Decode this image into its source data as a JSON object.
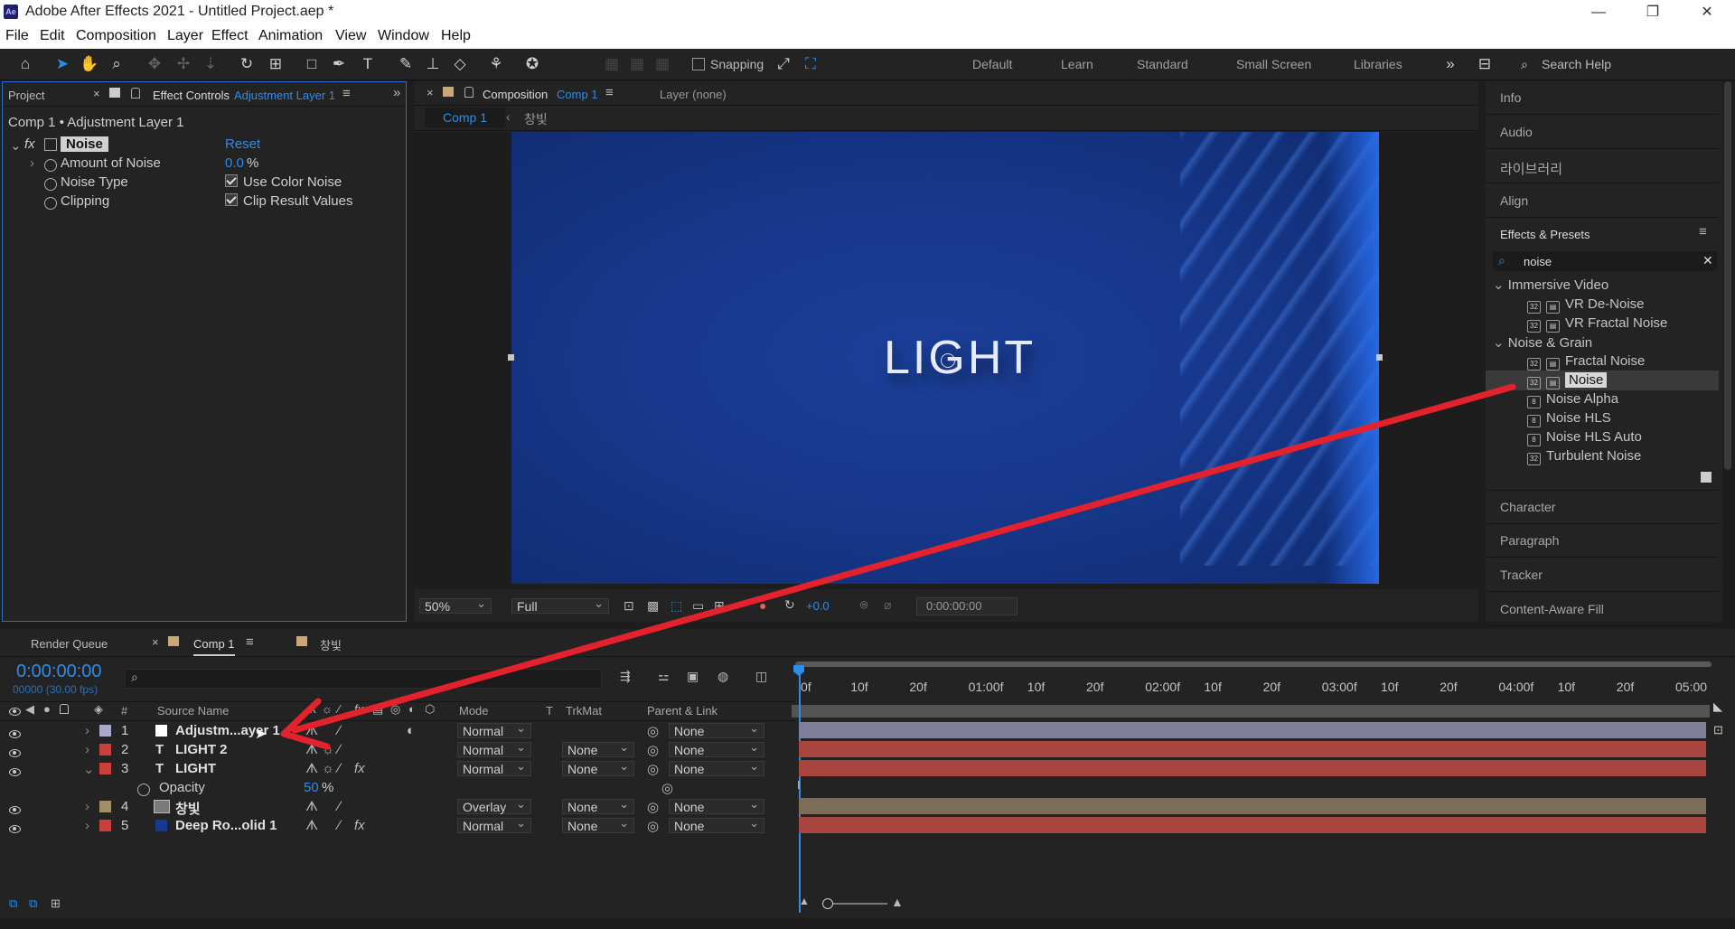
{
  "app": {
    "title": "Adobe After Effects 2021 - Untitled Project.aep *",
    "icon_text": "Ae"
  },
  "menu": [
    "File",
    "Edit",
    "Composition",
    "Layer",
    "Effect",
    "Animation",
    "View",
    "Window",
    "Help"
  ],
  "toolbar": {
    "snapping_label": "Snapping",
    "workspaces": [
      "Default",
      "Learn",
      "Standard",
      "Small Screen",
      "Libraries"
    ],
    "search_placeholder": "Search Help"
  },
  "project_panel": {
    "tab_project": "Project",
    "tab_effect_controls": "Effect Controls",
    "effect_controls_target": "Adjustment Layer 1"
  },
  "effect_controls": {
    "breadcrumb": "Comp 1 • Adjustment Layer 1",
    "effect_name": "Noise",
    "reset_label": "Reset",
    "fx_label": "fx",
    "props": [
      {
        "name": "Amount of Noise",
        "value": "0.0",
        "unit": "%"
      },
      {
        "name": "Noise Type",
        "checkbox_label": "Use Color Noise"
      },
      {
        "name": "Clipping",
        "checkbox_label": "Clip Result Values"
      }
    ]
  },
  "composition_panel": {
    "tab_label": "Composition",
    "tab_comp": "Comp 1",
    "layer_tab": "Layer (none)",
    "sub_tabs": [
      "Comp 1",
      "창빛"
    ],
    "viewer_text": "LIGHT",
    "zoom": "50%",
    "resolution": "Full",
    "exposure": "+0.0",
    "timecode": "0:00:00:00"
  },
  "right_panel": {
    "items_top": [
      "Info",
      "Audio",
      "라이브러리",
      "Align"
    ],
    "effects_presets": {
      "title": "Effects & Presets",
      "search_value": "noise",
      "groups": [
        {
          "name": "Immersive Video",
          "items": [
            "VR De-Noise",
            "VR Fractal Noise"
          ]
        },
        {
          "name": "Noise & Grain",
          "items": [
            "Fractal Noise",
            "Noise",
            "Noise Alpha",
            "Noise HLS",
            "Noise HLS Auto",
            "Turbulent Noise"
          ]
        }
      ],
      "selected_item": "Noise"
    },
    "items_bottom": [
      "Character",
      "Paragraph",
      "Tracker",
      "Content-Aware Fill"
    ]
  },
  "timeline": {
    "tabs": [
      "Render Queue",
      "Comp 1",
      "창빛"
    ],
    "timecode": "0:00:00:00",
    "fps_label": "00000 (30.00 fps)",
    "columns": {
      "number": "#",
      "source": "Source Name",
      "mode": "Mode",
      "t": "T",
      "trkmat": "TrkMat",
      "parent": "Parent & Link"
    },
    "ruler": [
      "0f",
      "10f",
      "20f",
      "01:00f",
      "10f",
      "20f",
      "02:00f",
      "10f",
      "20f",
      "03:00f",
      "10f",
      "20f",
      "04:00f",
      "10f",
      "20f",
      "05:00"
    ],
    "layers": [
      {
        "num": "1",
        "type": "",
        "name": "Adjustm...ayer 1",
        "mode": "Normal",
        "trkmat": "",
        "parent": "None",
        "label_color": "#a9a9cc",
        "bar_color": "#7f7f9c",
        "fx": false
      },
      {
        "num": "2",
        "type": "T",
        "name": "LIGHT 2",
        "mode": "Normal",
        "trkmat": "None",
        "parent": "None",
        "label_color": "#c9403a",
        "bar_color": "#a8453f",
        "fx": false
      },
      {
        "num": "3",
        "type": "T",
        "name": "LIGHT",
        "mode": "Normal",
        "trkmat": "None",
        "parent": "None",
        "label_color": "#c9403a",
        "bar_color": "#a8453f",
        "fx": true
      },
      {
        "num": "4",
        "type": "",
        "name": "창빛",
        "mode": "Overlay",
        "trkmat": "None",
        "parent": "None",
        "label_color": "#a38e6a",
        "bar_color": "#7c6e58",
        "fx": false
      },
      {
        "num": "5",
        "type": "",
        "name": "Deep Ro...olid 1",
        "mode": "Normal",
        "trkmat": "None",
        "parent": "None",
        "label_color": "#c9403a",
        "bar_color": "#a8453f",
        "fx": true
      }
    ],
    "opacity": {
      "name": "Opacity",
      "value": "50",
      "unit": "%"
    }
  },
  "colors": {
    "accent": "#2d8ceb",
    "arrow": "#e3222d",
    "comp_bg": "#163a93"
  }
}
